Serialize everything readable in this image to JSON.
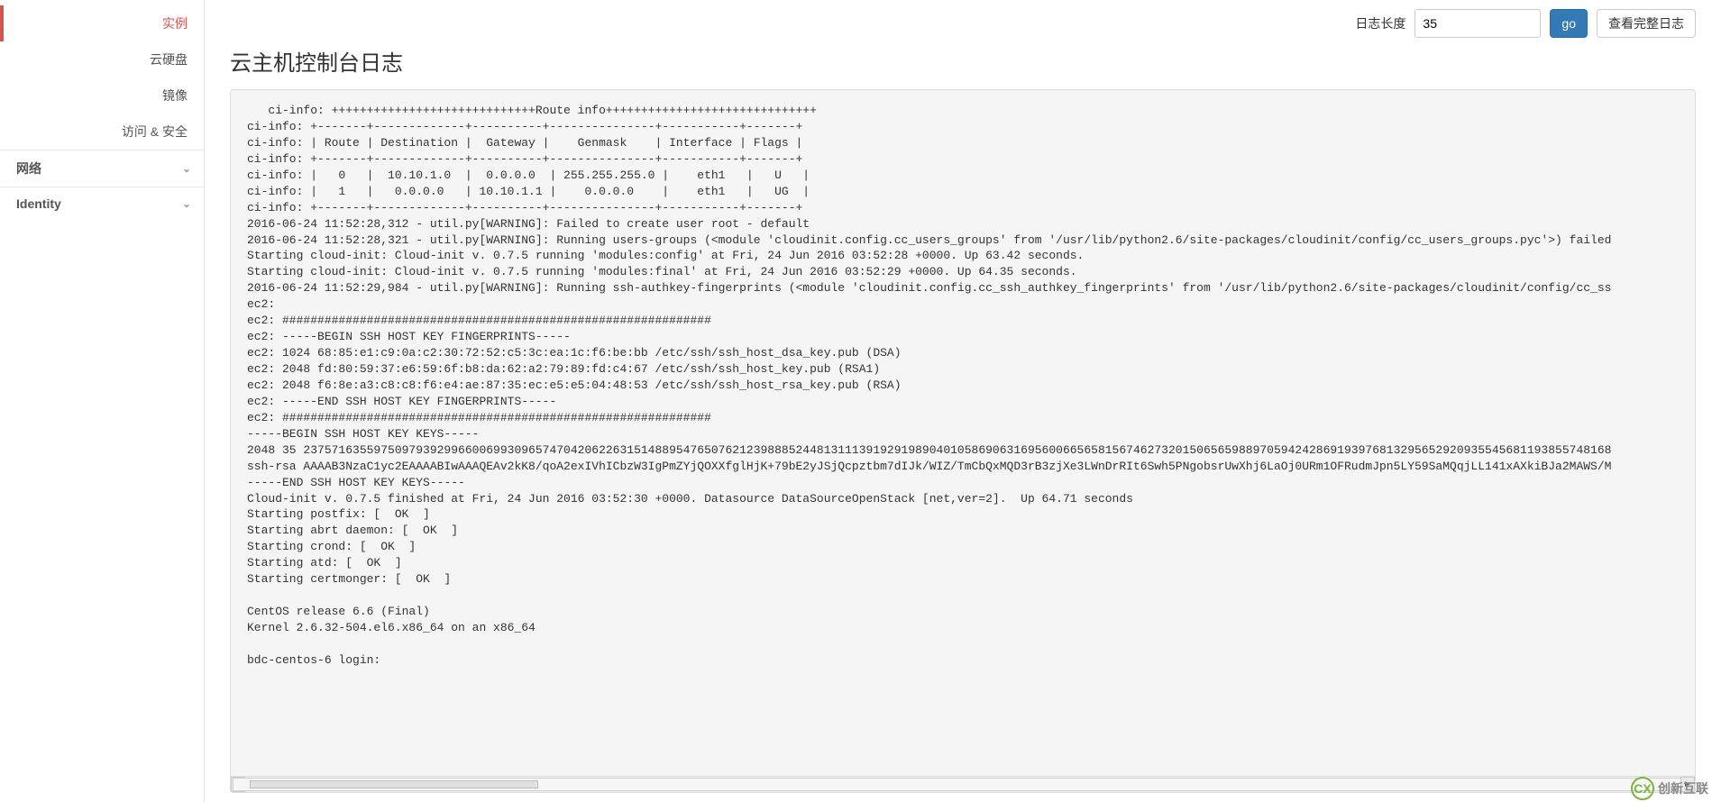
{
  "sidebar": {
    "items": [
      {
        "label": "实例",
        "active": true
      },
      {
        "label": "云硬盘",
        "active": false
      },
      {
        "label": "镜像",
        "active": false
      },
      {
        "label": "访问 & 安全",
        "active": false
      }
    ],
    "sections": [
      {
        "label": "网络"
      },
      {
        "label": "Identity"
      }
    ]
  },
  "topbar": {
    "length_label": "日志长度",
    "length_value": "35",
    "go_label": "go",
    "full_log_label": "查看完整日志"
  },
  "title": "云主机控制台日志",
  "log_lines": [
    "   ci-info: +++++++++++++++++++++++++++++Route info++++++++++++++++++++++++++++++",
    "ci-info: +-------+-------------+----------+---------------+-----------+-------+",
    "ci-info: | Route | Destination |  Gateway |    Genmask    | Interface | Flags |",
    "ci-info: +-------+-------------+----------+---------------+-----------+-------+",
    "ci-info: |   0   |  10.10.1.0  |  0.0.0.0  | 255.255.255.0 |    eth1   |   U   |",
    "ci-info: |   1   |   0.0.0.0   | 10.10.1.1 |    0.0.0.0    |    eth1   |   UG  |",
    "ci-info: +-------+-------------+----------+---------------+-----------+-------+",
    "2016-06-24 11:52:28,312 - util.py[WARNING]: Failed to create user root - default",
    "2016-06-24 11:52:28,321 - util.py[WARNING]: Running users-groups (<module 'cloudinit.config.cc_users_groups' from '/usr/lib/python2.6/site-packages/cloudinit/config/cc_users_groups.pyc'>) failed",
    "Starting cloud-init: Cloud-init v. 0.7.5 running 'modules:config' at Fri, 24 Jun 2016 03:52:28 +0000. Up 63.42 seconds.",
    "Starting cloud-init: Cloud-init v. 0.7.5 running 'modules:final' at Fri, 24 Jun 2016 03:52:29 +0000. Up 64.35 seconds.",
    "2016-06-24 11:52:29,984 - util.py[WARNING]: Running ssh-authkey-fingerprints (<module 'cloudinit.config.cc_ssh_authkey_fingerprints' from '/usr/lib/python2.6/site-packages/cloudinit/config/cc_ss",
    "ec2: ",
    "ec2: #############################################################",
    "ec2: -----BEGIN SSH HOST KEY FINGERPRINTS-----",
    "ec2: 1024 68:85:e1:c9:0a:c2:30:72:52:c5:3c:ea:1c:f6:be:bb /etc/ssh/ssh_host_dsa_key.pub (DSA)",
    "ec2: 2048 fd:80:59:37:e6:59:6f:b8:da:62:a2:79:89:fd:c4:67 /etc/ssh/ssh_host_key.pub (RSA1)",
    "ec2: 2048 f6:8e:a3:c8:c8:f6:e4:ae:87:35:ec:e5:e5:04:48:53 /etc/ssh/ssh_host_rsa_key.pub (RSA)",
    "ec2: -----END SSH HOST KEY FINGERPRINTS-----",
    "ec2: #############################################################",
    "-----BEGIN SSH HOST KEY KEYS-----",
    "2048 35 237571635597509793929966006993096574704206226315148895476507621239888524481311139192919890401058690631695600665658156746273201506565988970594242869193976813295652920935545681193855748168",
    "ssh-rsa AAAAB3NzaC1yc2EAAAABIwAAAQEAv2kK8/qoA2exIVhICbzW3IgPmZYjQOXXfglHjK+79bE2yJSjQcpztbm7dIJk/WIZ/TmCbQxMQD3rB3zjXe3LWnDrRIt6Swh5PNgobsrUwXhj6LaOj0URm1OFRudmJpn5LY59SaMQqjLL141xAXkiBJa2MAWS/M",
    "-----END SSH HOST KEY KEYS-----",
    "Cloud-init v. 0.7.5 finished at Fri, 24 Jun 2016 03:52:30 +0000. Datasource DataSourceOpenStack [net,ver=2].  Up 64.71 seconds",
    "Starting postfix: [  OK  ]",
    "Starting abrt daemon: [  OK  ]",
    "Starting crond: [  OK  ]",
    "Starting atd: [  OK  ]",
    "Starting certmonger: [  OK  ]",
    "",
    "CentOS release 6.6 (Final)",
    "Kernel 2.6.32-504.el6.x86_64 on an x86_64",
    "",
    "bdc-centos-6 login: "
  ],
  "watermark": {
    "brand": "创新互联",
    "icon_text": "CX"
  }
}
